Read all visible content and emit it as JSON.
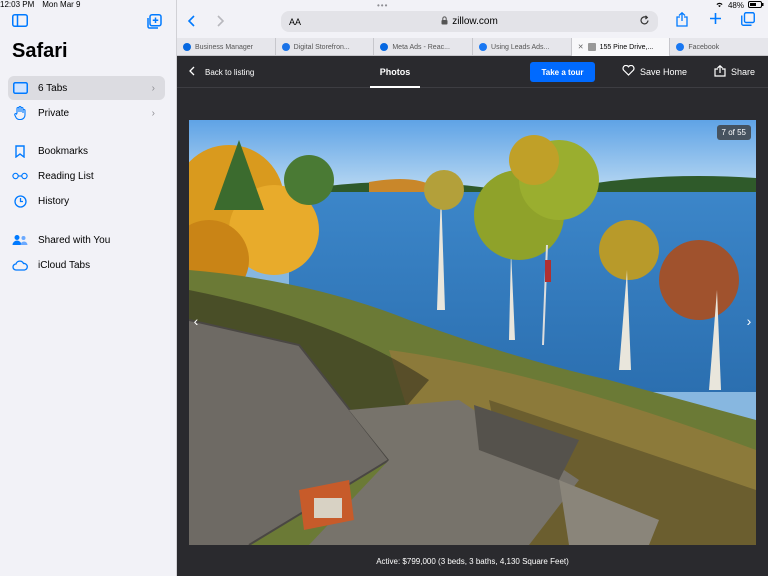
{
  "status": {
    "time": "12:03 PM",
    "date": "Mon Mar 9",
    "battery": "48%"
  },
  "sidebar": {
    "title": "Safari",
    "items": [
      {
        "label": "6 Tabs",
        "icon": "tabs-icon"
      },
      {
        "label": "Private",
        "icon": "hand-icon"
      },
      {
        "label": "Bookmarks",
        "icon": "bookmark-icon"
      },
      {
        "label": "Reading List",
        "icon": "glasses-icon"
      },
      {
        "label": "History",
        "icon": "clock-icon"
      },
      {
        "label": "Shared with You",
        "icon": "people-icon"
      },
      {
        "label": "iCloud Tabs",
        "icon": "cloud-icon"
      }
    ]
  },
  "addressbar": {
    "text_size": "AA",
    "url": "zillow.com"
  },
  "tabs": [
    {
      "label": "Business Manager",
      "color": "#0668E1"
    },
    {
      "label": "Digital Storefron...",
      "color": "#1a73e8"
    },
    {
      "label": "Meta Ads - Reac...",
      "color": "#0668E1"
    },
    {
      "label": "Using Leads Ads...",
      "color": "#1877F2"
    },
    {
      "label": "155 Pine Drive,...",
      "color": "#999999"
    },
    {
      "label": "Facebook",
      "color": "#1877F2"
    }
  ],
  "listing": {
    "back": "Back to listing",
    "photos_tab": "Photos",
    "tour_button": "Take a tour",
    "save_home": "Save Home",
    "share": "Share",
    "counter": "7 of 55",
    "caption": "Active: $799,000 (3 beds, 3 baths, 4,130 Square Feet)"
  },
  "colors": {
    "accent": "#007aff",
    "zillow_blue": "#006aff"
  }
}
